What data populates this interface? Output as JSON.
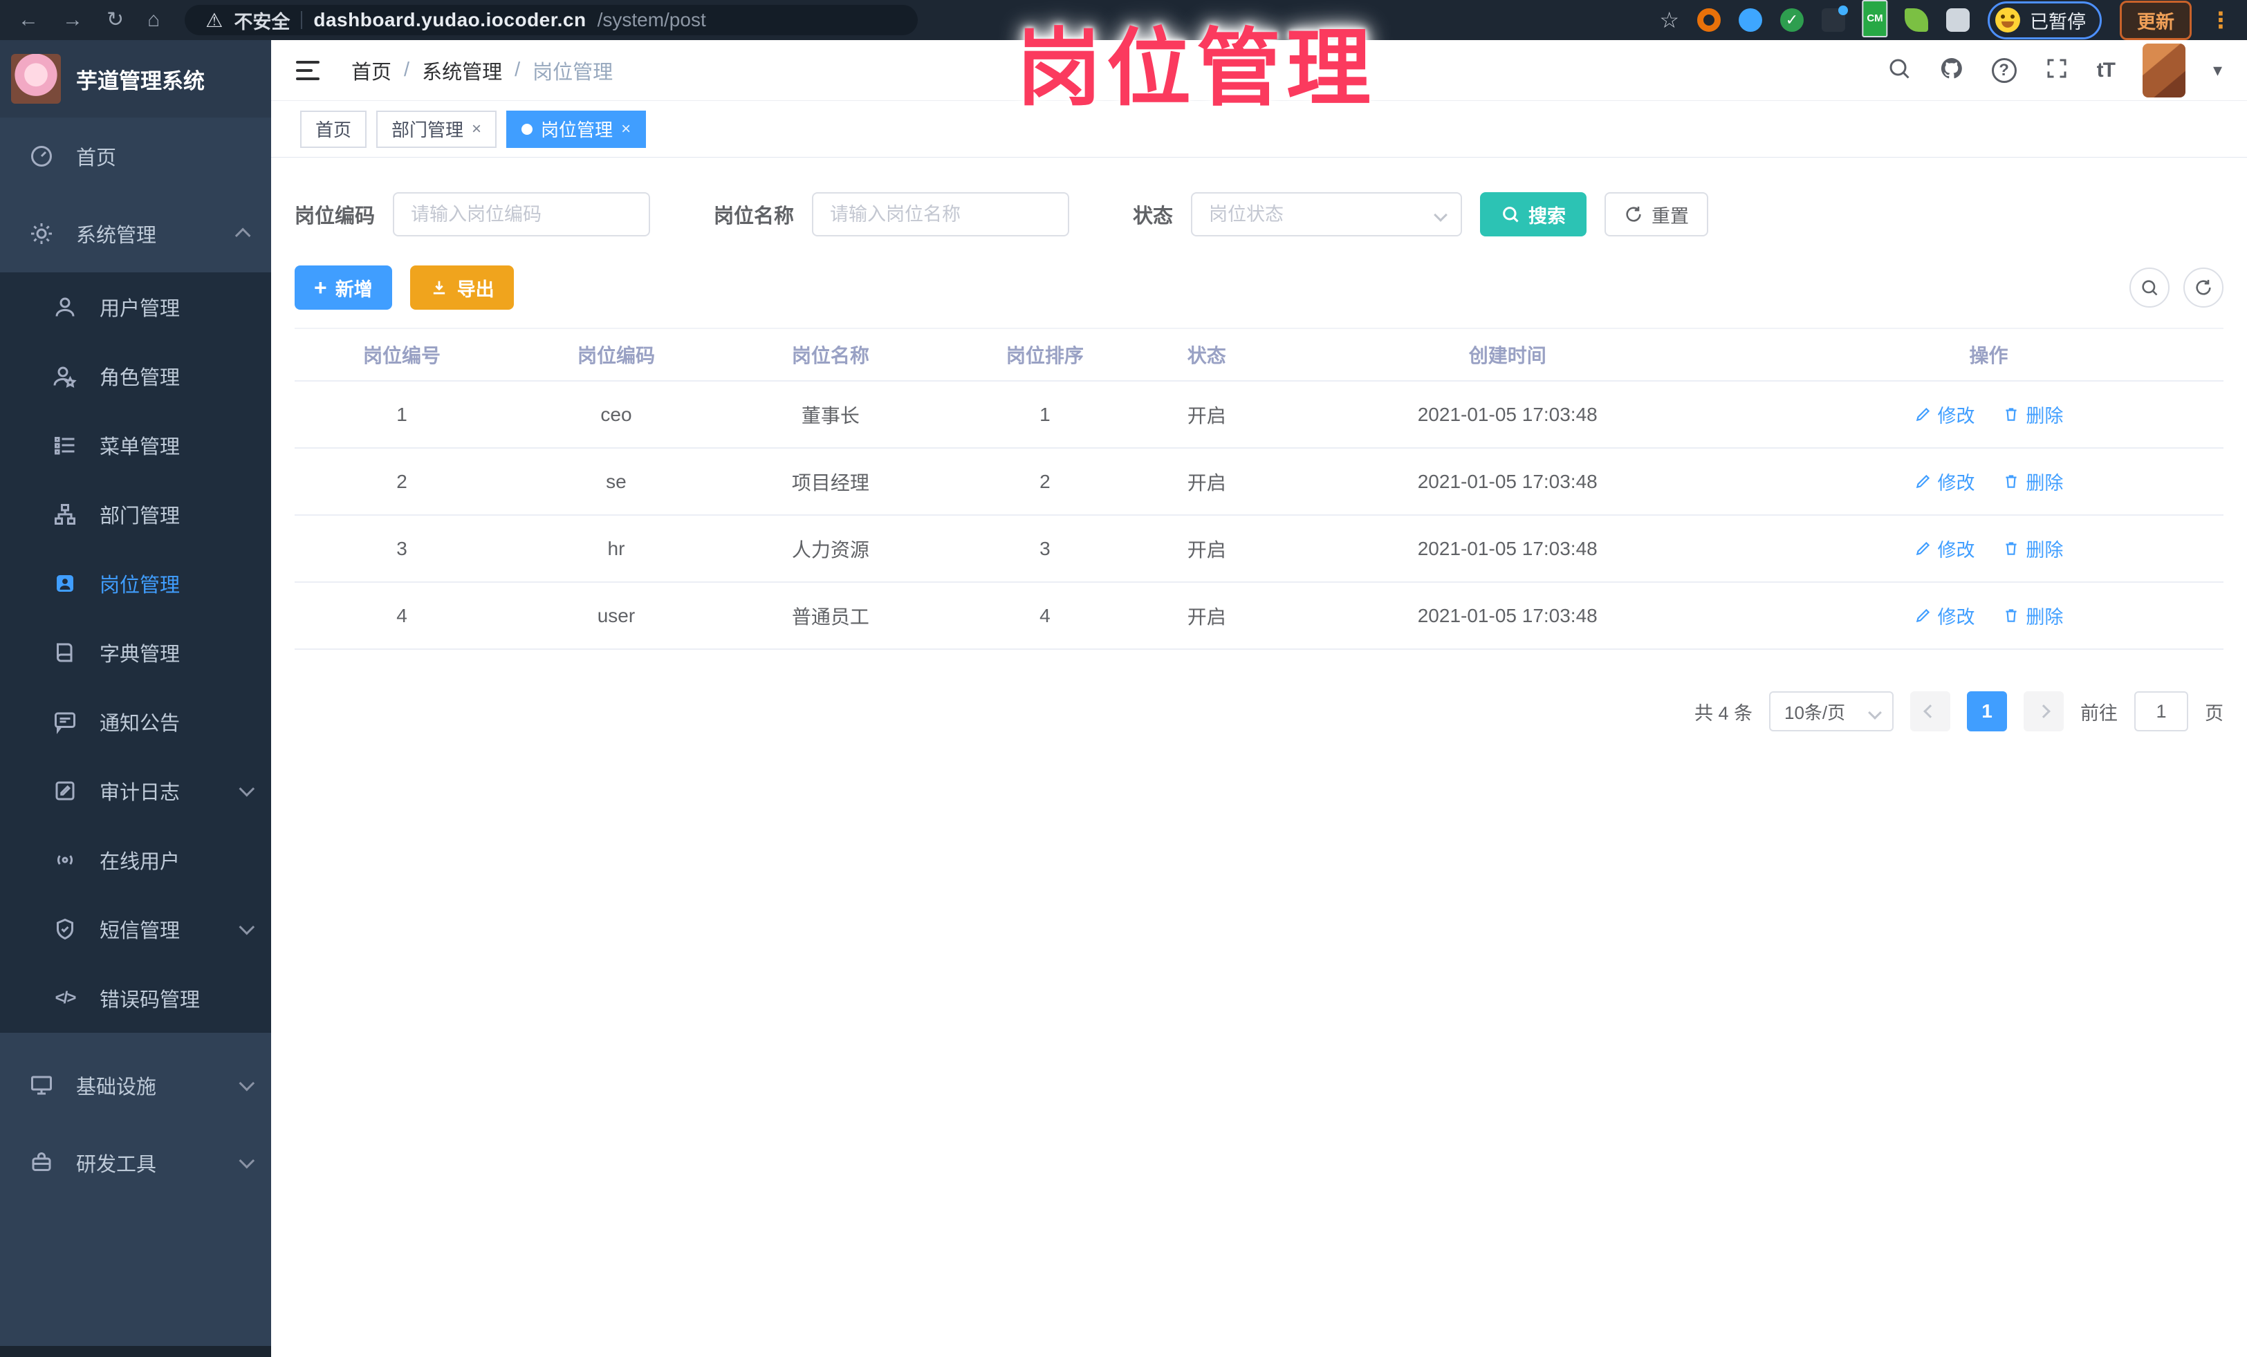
{
  "glyphs": {
    "back": "←",
    "forward": "→",
    "reload": "↻",
    "home": "⌂",
    "warning": "⚠",
    "star": "☆",
    "check": "✓",
    "kebab": "⋮",
    "close": "×",
    "caret": "▾",
    "plus": "+",
    "slash": "/",
    "code": "</>",
    "font_size": "tT",
    "question": "?"
  },
  "browser": {
    "security_label": "不安全",
    "url_host": "dashboard.yudao.iocoder.cn",
    "url_path": "/system/post",
    "extension_badge": "CM",
    "paused_label": "已暂停",
    "update_label": "更新"
  },
  "overlay": {
    "title": "岗位管理",
    "color": "#fb3a5e"
  },
  "sidebar": {
    "app_title": "芋道管理系统",
    "items": [
      {
        "label": "首页"
      },
      {
        "label": "系统管理"
      },
      {
        "label": "用户管理"
      },
      {
        "label": "角色管理"
      },
      {
        "label": "菜单管理"
      },
      {
        "label": "部门管理"
      },
      {
        "label": "岗位管理"
      },
      {
        "label": "字典管理"
      },
      {
        "label": "通知公告"
      },
      {
        "label": "审计日志"
      },
      {
        "label": "在线用户"
      },
      {
        "label": "短信管理"
      },
      {
        "label": "错误码管理"
      },
      {
        "label": "基础设施"
      },
      {
        "label": "研发工具"
      }
    ]
  },
  "header": {
    "breadcrumb": [
      "首页",
      "系统管理",
      "岗位管理"
    ]
  },
  "tabs": [
    {
      "label": "首页"
    },
    {
      "label": "部门管理"
    },
    {
      "label": "岗位管理"
    }
  ],
  "filters": {
    "post_code_label": "岗位编码",
    "post_code_placeholder": "请输入岗位编码",
    "post_name_label": "岗位名称",
    "post_name_placeholder": "请输入岗位名称",
    "status_label": "状态",
    "status_placeholder": "岗位状态",
    "search_label": "搜索",
    "reset_label": "重置"
  },
  "toolbar": {
    "add_label": "新增",
    "export_label": "导出"
  },
  "table": {
    "columns": [
      "岗位编号",
      "岗位编码",
      "岗位名称",
      "岗位排序",
      "状态",
      "创建时间",
      "操作"
    ],
    "edit_label": "修改",
    "delete_label": "删除",
    "rows": [
      {
        "id": "1",
        "code": "ceo",
        "name": "董事长",
        "sort": "1",
        "status": "开启",
        "created": "2021-01-05 17:03:48"
      },
      {
        "id": "2",
        "code": "se",
        "name": "项目经理",
        "sort": "2",
        "status": "开启",
        "created": "2021-01-05 17:03:48"
      },
      {
        "id": "3",
        "code": "hr",
        "name": "人力资源",
        "sort": "3",
        "status": "开启",
        "created": "2021-01-05 17:03:48"
      },
      {
        "id": "4",
        "code": "user",
        "name": "普通员工",
        "sort": "4",
        "status": "开启",
        "created": "2021-01-05 17:03:48"
      }
    ]
  },
  "pagination": {
    "total": "共 4 条",
    "page_size": "10条/页",
    "current": "1",
    "goto_label": "前往",
    "goto_value": "1",
    "page_unit": "页"
  },
  "colors": {
    "accent_blue": "#409eff",
    "teal_search": "#2cc3b4",
    "orange_export": "#f0a41d",
    "pink_overlay": "#fb3a5e",
    "sidebar_bg": "#304156",
    "submenu_bg": "#1f2d3d"
  }
}
